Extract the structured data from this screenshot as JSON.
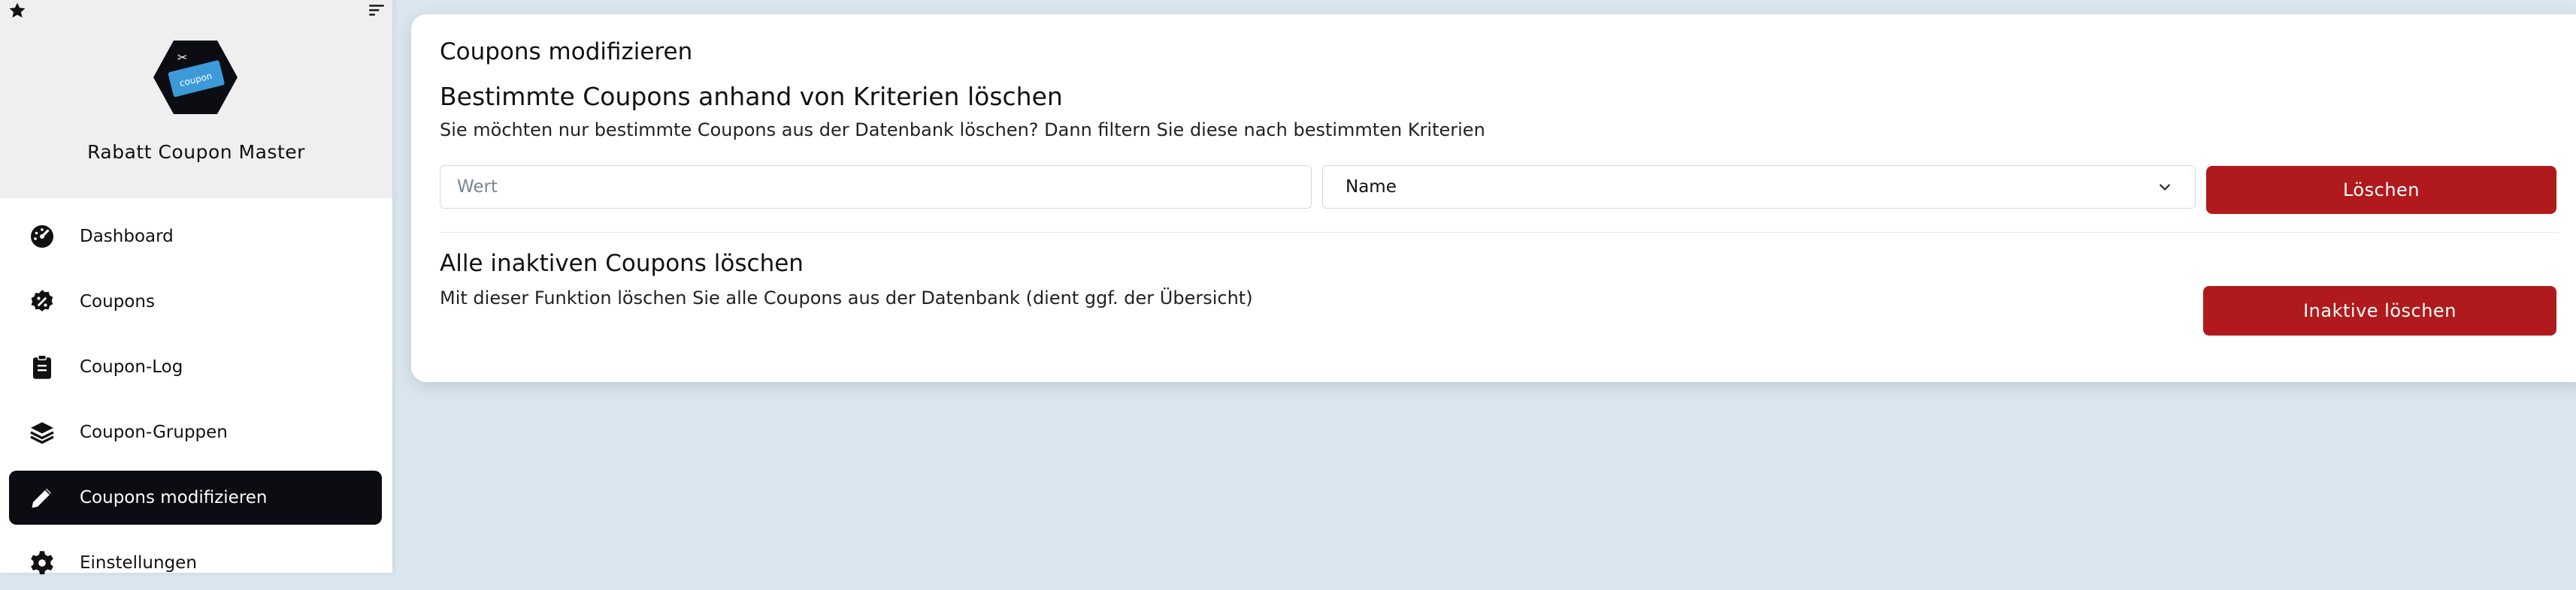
{
  "sidebar": {
    "app_name": "Rabatt Coupon Master",
    "logo_text": "coupon",
    "items": [
      {
        "label": "Dashboard",
        "icon": "dashboard-gauge-icon"
      },
      {
        "label": "Coupons",
        "icon": "percent-badge-icon"
      },
      {
        "label": "Coupon-Log",
        "icon": "clipboard-icon"
      },
      {
        "label": "Coupon-Gruppen",
        "icon": "layers-icon"
      },
      {
        "label": "Coupons modifizieren",
        "icon": "pencil-icon",
        "active": true
      },
      {
        "label": "Einstellungen",
        "icon": "gear-icon"
      }
    ]
  },
  "main": {
    "card_title": "Coupons modifizieren",
    "section1": {
      "title": "Bestimmte Coupons anhand von Kriterien löschen",
      "description": "Sie möchten nur bestimmte Coupons aus der Datenbank löschen? Dann filtern Sie diese nach bestimmten Kriterien",
      "value_placeholder": "Wert",
      "criteria_selected": "Name",
      "button_label": "Löschen"
    },
    "section2": {
      "title": "Alle inaktiven Coupons löschen",
      "description": "Mit dieser Funktion löschen Sie alle Coupons aus der Datenbank (dient ggf. der Übersicht)",
      "button_label": "Inaktive löschen"
    }
  },
  "colors": {
    "accent_red": "#b01a1c",
    "active_nav": "#0b0d12",
    "background": "#dce6ee",
    "logo_hex": "#0b0d12",
    "logo_ticket": "#3d9ad8"
  }
}
